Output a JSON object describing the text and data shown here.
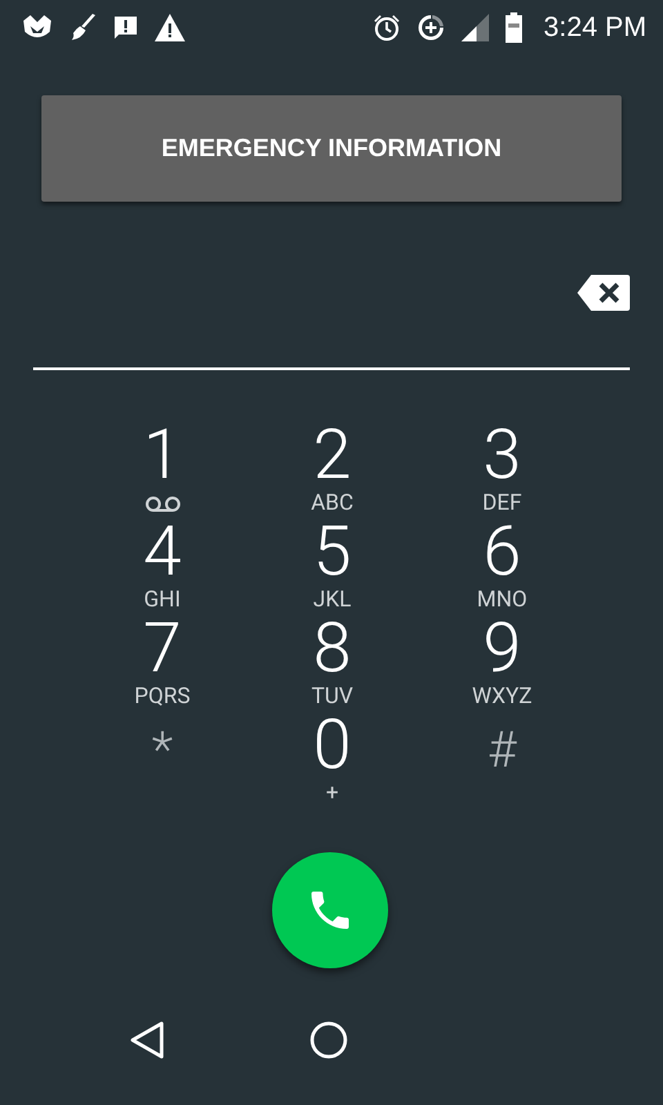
{
  "status_bar": {
    "time": "3:24 PM"
  },
  "emergency_button": {
    "label": "EMERGENCY INFORMATION"
  },
  "keys": [
    {
      "kind": "voicemail",
      "digit": "1"
    },
    {
      "kind": "letters",
      "digit": "2",
      "letters": "ABC"
    },
    {
      "kind": "letters",
      "digit": "3",
      "letters": "DEF"
    },
    {
      "kind": "letters",
      "digit": "4",
      "letters": "GHI"
    },
    {
      "kind": "letters",
      "digit": "5",
      "letters": "JKL"
    },
    {
      "kind": "letters",
      "digit": "6",
      "letters": "MNO"
    },
    {
      "kind": "letters",
      "digit": "7",
      "letters": "PQRS"
    },
    {
      "kind": "letters",
      "digit": "8",
      "letters": "TUV"
    },
    {
      "kind": "letters",
      "digit": "9",
      "letters": "WXYZ"
    },
    {
      "kind": "symbol",
      "digit": "*"
    },
    {
      "kind": "letters",
      "digit": "0",
      "letters": "+"
    },
    {
      "kind": "symbol",
      "digit": "#"
    }
  ]
}
